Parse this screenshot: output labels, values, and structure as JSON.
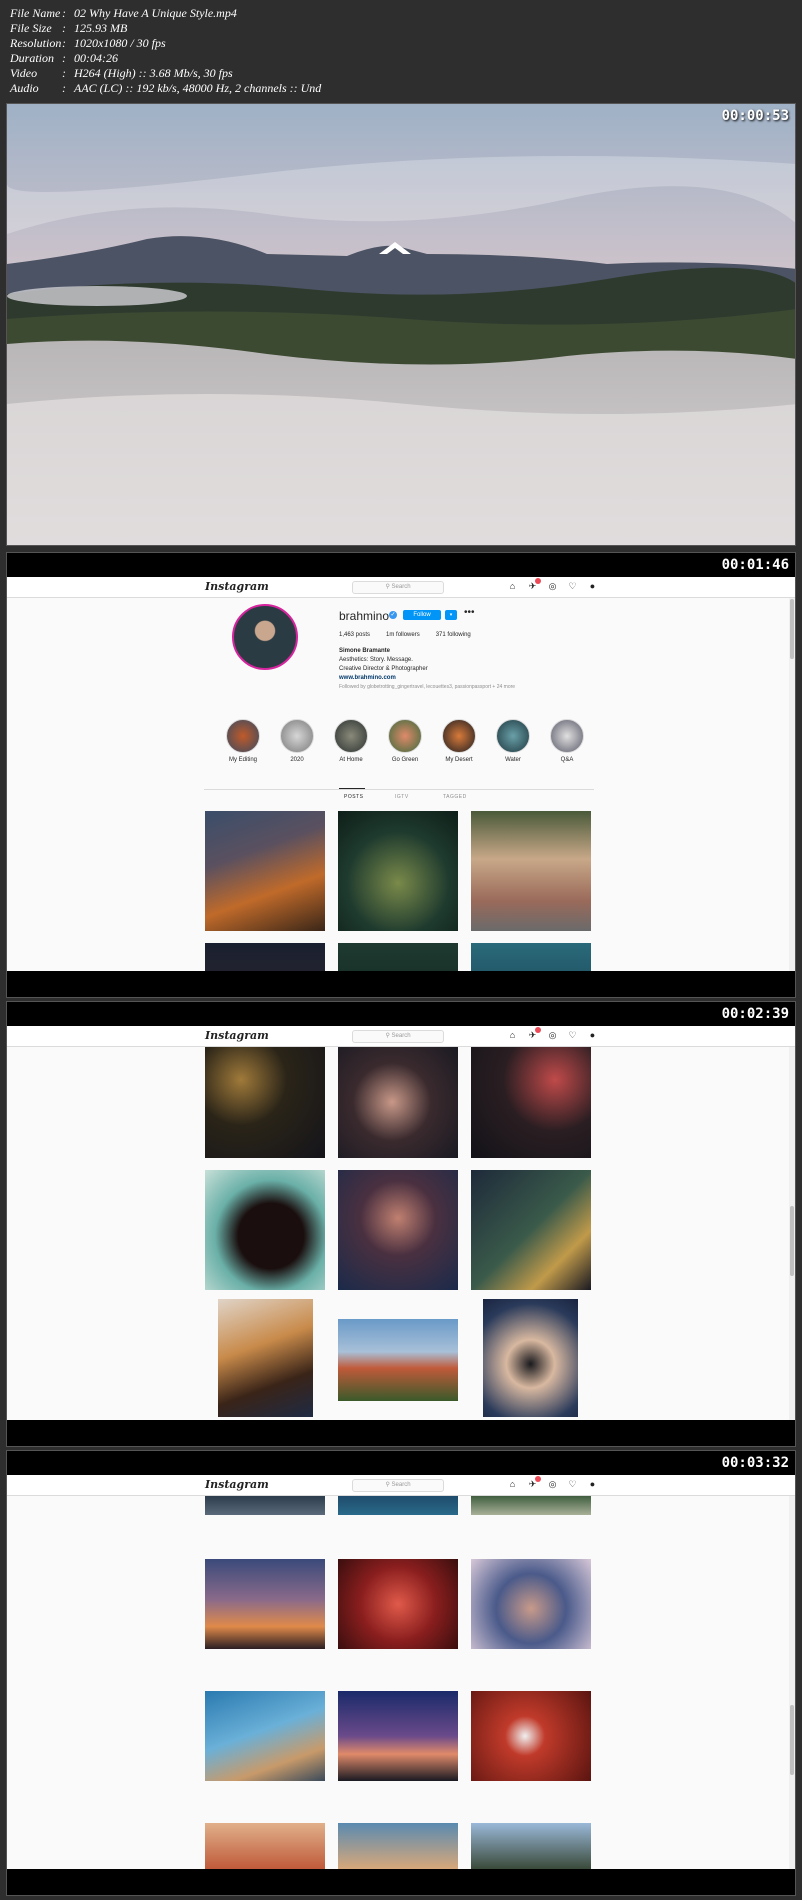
{
  "file_info": [
    {
      "key": "File Name",
      "value": "02 Why Have A Unique Style.mp4"
    },
    {
      "key": "File Size",
      "value": "125.93 MB"
    },
    {
      "key": "Resolution",
      "value": "1020x1080 / 30 fps"
    },
    {
      "key": "Duration",
      "value": "00:04:26"
    },
    {
      "key": "Video",
      "value": "H264 (High) :: 3.68 Mb/s, 30 fps"
    },
    {
      "key": "Audio",
      "value": "AAC (LC) :: 192 kb/s, 48000 Hz, 2 channels :: Und"
    }
  ],
  "timestamps": [
    "00:00:53",
    "00:01:46",
    "00:02:39",
    "00:03:32"
  ],
  "instagram": {
    "logo": "Instagram",
    "search_placeholder": "Search",
    "profile": {
      "username": "brahmino",
      "follow_label": "Follow",
      "dropdown_label": "▾",
      "more_label": "•••",
      "posts": "1,463 posts",
      "followers": "1m followers",
      "following": "371 following",
      "name": "Simone Bramante",
      "bio_line1": "Aesthetics: Story. Message.",
      "bio_line2": "Creative Director & Photographer",
      "link": "www.brahmino.com",
      "followed_by": "Followed by globetrotting_gingertravel, lecouettes3, passionpassport + 24 more"
    },
    "highlights": [
      "My Editing",
      "2020",
      "At Home",
      "Go Green",
      "My Desert",
      "Water",
      "Q&A"
    ],
    "tabs": [
      "POSTS",
      "IGTV",
      "TAGGED"
    ]
  },
  "colors": {
    "follow_blue": "#0095f6",
    "notification_red": "#ed4956",
    "page_bg": "#2e2e2e"
  }
}
